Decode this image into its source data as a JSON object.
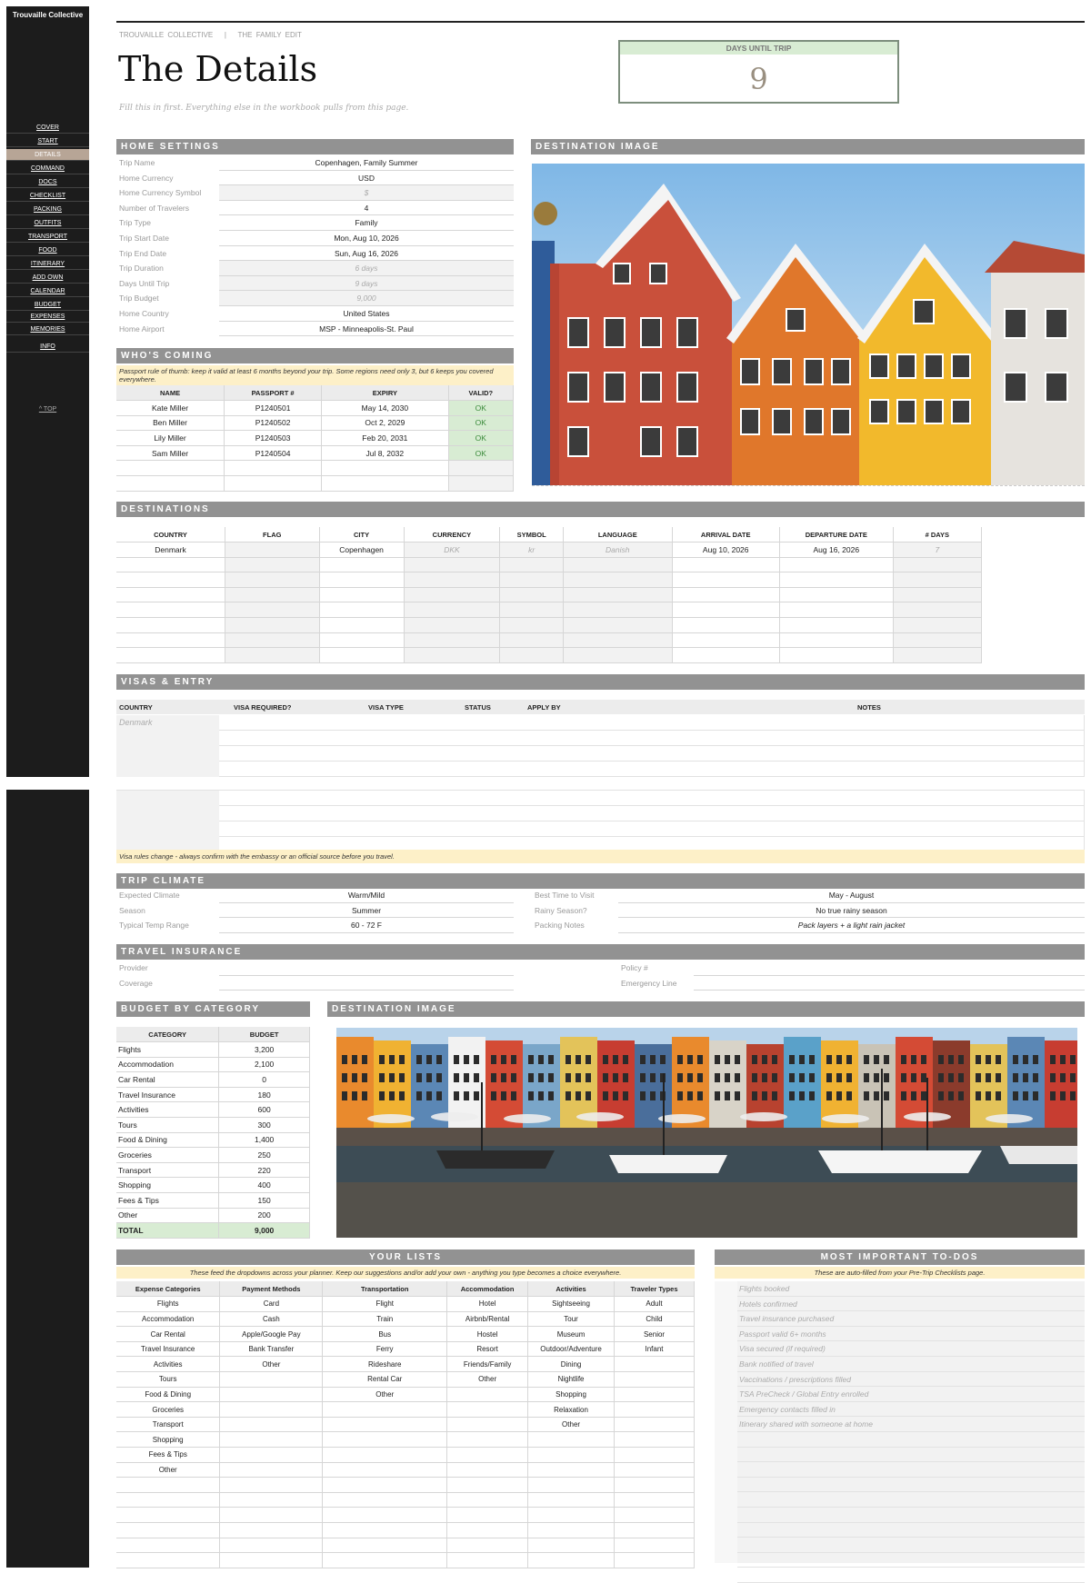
{
  "sidebar": {
    "brand": "Trouvaille Collective",
    "items": [
      "COVER",
      "START",
      "DETAILS",
      "COMMAND",
      "DOCS",
      "CHECKLIST",
      "PACKING",
      "OUTFITS",
      "TRANSPORT",
      "FOOD",
      "ITINERARY",
      "ADD OWN",
      "CALENDAR",
      "BUDGET",
      "EXPENSES",
      "MEMORIES",
      "INFO"
    ],
    "top": "^ TOP"
  },
  "header": {
    "breadcrumb_1": "TROUVAILLE COLLECTIVE",
    "separator": "|",
    "breadcrumb_2": "THE FAMILY EDIT",
    "title": "The Details",
    "subtitle": "Fill this in first. Everything else in the workbook pulls from this page.",
    "days_label": "DAYS UNTIL TRIP",
    "days_value": "9"
  },
  "home": {
    "title": "HOME SETTINGS",
    "rows": [
      {
        "k": "Trip Name",
        "v": "Copenhagen, Family Summer"
      },
      {
        "k": "Home Currency",
        "v": "USD"
      },
      {
        "k": "Home Currency Symbol",
        "v": "$"
      },
      {
        "k": "Number of Travelers",
        "v": "4"
      },
      {
        "k": "Trip Type",
        "v": "Family"
      },
      {
        "k": "Trip Start Date",
        "v": "Mon, Aug 10, 2026"
      },
      {
        "k": "Trip End Date",
        "v": "Sun, Aug 16, 2026"
      },
      {
        "k": "Trip Duration",
        "v": "6 days"
      },
      {
        "k": "Days Until Trip",
        "v": "9 days"
      },
      {
        "k": "Trip Budget",
        "v": "9,000"
      },
      {
        "k": "Home Country",
        "v": "United States"
      },
      {
        "k": "Home Airport",
        "v": "MSP - Minneapolis-St. Paul"
      }
    ]
  },
  "dest_image_title": "DESTINATION IMAGE",
  "who": {
    "title": "WHO'S COMING",
    "note": "Passport rule of thumb: keep it valid at least 6 months beyond your trip. Some regions need only 3, but 6 keeps you covered everywhere.",
    "headers": [
      "NAME",
      "PASSPORT #",
      "EXPIRY",
      "VALID?"
    ],
    "rows": [
      [
        "Kate Miller",
        "P1240501",
        "May 14, 2030",
        "OK"
      ],
      [
        "Ben Miller",
        "P1240502",
        "Oct 2, 2029",
        "OK"
      ],
      [
        "Lily Miller",
        "P1240503",
        "Feb 20, 2031",
        "OK"
      ],
      [
        "Sam Miller",
        "P1240504",
        "Jul 8, 2032",
        "OK"
      ]
    ]
  },
  "destinations": {
    "title": "DESTINATIONS",
    "headers": [
      "COUNTRY",
      "FLAG",
      "CITY",
      "CURRENCY",
      "SYMBOL",
      "LANGUAGE",
      "ARRIVAL DATE",
      "DEPARTURE DATE",
      "# DAYS"
    ],
    "rows": [
      [
        "Denmark",
        "",
        "Copenhagen",
        "DKK",
        "kr",
        "Danish",
        "Aug 10, 2026",
        "Aug 16, 2026",
        "7"
      ]
    ]
  },
  "visas": {
    "title": "VISAS & ENTRY",
    "headers": [
      "COUNTRY",
      "VISA REQUIRED?",
      "VISA TYPE",
      "STATUS",
      "APPLY BY",
      "NOTES"
    ],
    "rows": [
      [
        "Denmark"
      ]
    ],
    "note": "Visa rules change - always confirm with the embassy or an official source before you travel."
  },
  "climate": {
    "title": "TRIP CLIMATE",
    "left": [
      {
        "k": "Expected Climate",
        "v": "Warm/Mild"
      },
      {
        "k": "Season",
        "v": "Summer"
      },
      {
        "k": "Typical Temp Range",
        "v": "60 - 72 F"
      }
    ],
    "right": [
      {
        "k": "Best Time to Visit",
        "v": "May - August"
      },
      {
        "k": "Rainy Season?",
        "v": "No true rainy season"
      },
      {
        "k": "Packing Notes",
        "v": "Pack layers + a light rain jacket"
      }
    ]
  },
  "insurance": {
    "title": "TRAVEL INSURANCE",
    "left": [
      "Provider",
      "Coverage"
    ],
    "right": [
      "Policy #",
      "Emergency Line"
    ]
  },
  "budget": {
    "title": "BUDGET BY CATEGORY",
    "headers": [
      "CATEGORY",
      "BUDGET"
    ],
    "rows": [
      [
        "Flights",
        "3,200"
      ],
      [
        "Accommodation",
        "2,100"
      ],
      [
        "Car Rental",
        "0"
      ],
      [
        "Travel Insurance",
        "180"
      ],
      [
        "Activities",
        "600"
      ],
      [
        "Tours",
        "300"
      ],
      [
        "Food & Dining",
        "1,400"
      ],
      [
        "Groceries",
        "250"
      ],
      [
        "Transport",
        "220"
      ],
      [
        "Shopping",
        "400"
      ],
      [
        "Fees & Tips",
        "150"
      ],
      [
        "Other",
        "200"
      ]
    ],
    "total": [
      "TOTAL",
      "9,000"
    ]
  },
  "lists": {
    "title": "YOUR LISTS",
    "note": "These feed the dropdowns across your planner. Keep our suggestions and/or add your own - anything you type becomes a choice everywhere.",
    "headers": [
      "Expense Categories",
      "Payment Methods",
      "Transportation",
      "Accommodation",
      "Activities",
      "Traveler Types"
    ],
    "cols": [
      [
        "Flights",
        "Accommodation",
        "Car Rental",
        "Travel Insurance",
        "Activities",
        "Tours",
        "Food & Dining",
        "Groceries",
        "Transport",
        "Shopping",
        "Fees & Tips",
        "Other"
      ],
      [
        "Card",
        "Cash",
        "Apple/Google Pay",
        "Bank Transfer",
        "Other"
      ],
      [
        "Flight",
        "Train",
        "Bus",
        "Ferry",
        "Rideshare",
        "Rental Car",
        "Other"
      ],
      [
        "Hotel",
        "Airbnb/Rental",
        "Hostel",
        "Resort",
        "Friends/Family",
        "Other"
      ],
      [
        "Sightseeing",
        "Tour",
        "Museum",
        "Outdoor/Adventure",
        "Dining",
        "Nightlife",
        "Shopping",
        "Relaxation",
        "Other"
      ],
      [
        "Adult",
        "Child",
        "Senior",
        "Infant"
      ]
    ]
  },
  "todos": {
    "title": "MOST IMPORTANT TO-DOS",
    "note": "These are auto-filled from your Pre-Trip Checklists page.",
    "items": [
      "Flights booked",
      "Hotels confirmed",
      "Travel insurance purchased",
      "Passport valid 6+ months",
      "Visa secured (if required)",
      "Bank notified of travel",
      "Vaccinations / prescriptions filled",
      "TSA PreCheck / Global Entry enrolled",
      "Emergency contacts filled in",
      "Itinerary shared with someone at home"
    ]
  },
  "colors": {
    "sidebar": "#1c1c1c",
    "active": "#b7a596",
    "bar": "#929292",
    "ok": "#d8ecd3",
    "note": "#fdf0c8"
  }
}
